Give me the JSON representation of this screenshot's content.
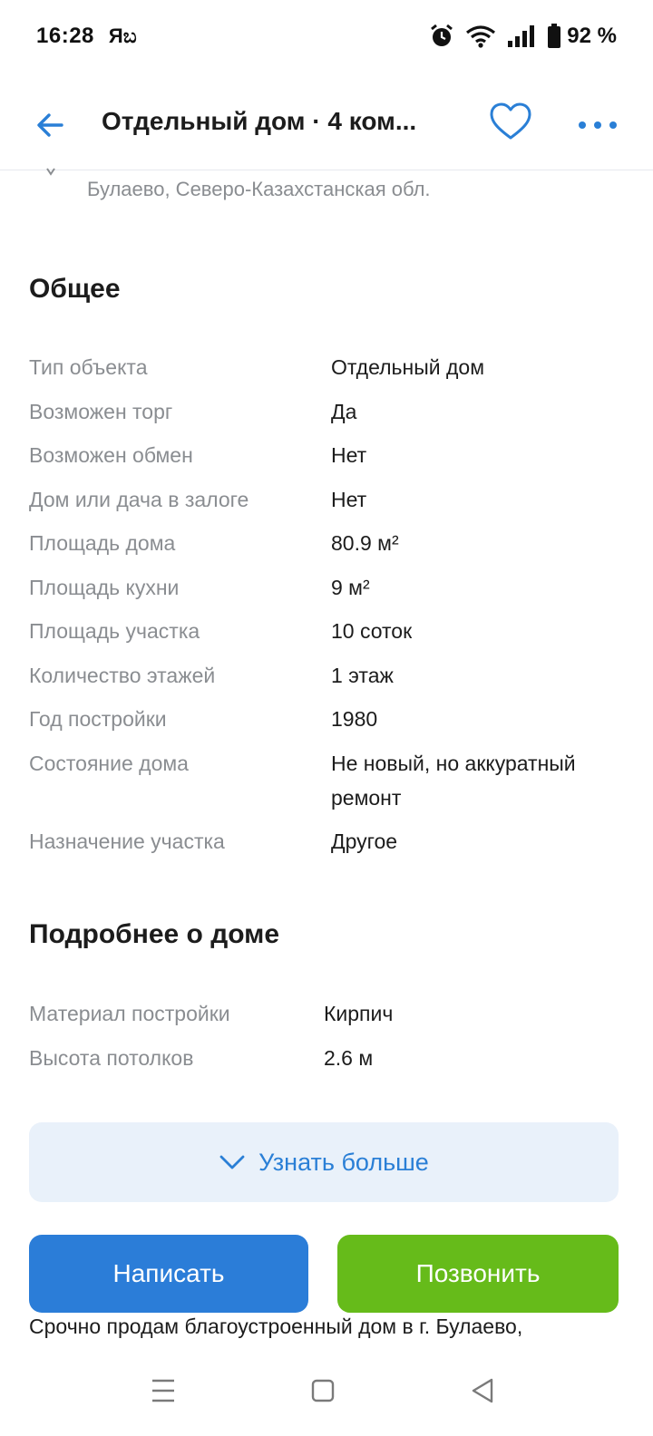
{
  "status_bar": {
    "time": "16:28",
    "notification": "Яಬ",
    "battery": "92 %"
  },
  "header": {
    "title": "Отдельный дом · 4 ком..."
  },
  "listing": {
    "address": "Булаево, Северо-Казахстанская обл."
  },
  "general": {
    "title": "Общее",
    "rows": [
      {
        "label": "Тип объекта",
        "value": "Отдельный дом"
      },
      {
        "label": "Возможен торг",
        "value": "Да"
      },
      {
        "label": "Возможен обмен",
        "value": "Нет"
      },
      {
        "label": "Дом или дача в залоге",
        "value": "Нет"
      },
      {
        "label": "Площадь дома",
        "value": "80.9 м²"
      },
      {
        "label": "Площадь кухни",
        "value": "9 м²"
      },
      {
        "label": "Площадь участка",
        "value": "10 соток"
      },
      {
        "label": "Количество этажей",
        "value": "1 этаж"
      },
      {
        "label": "Год постройки",
        "value": "1980"
      },
      {
        "label": "Состояние дома",
        "value": "Не новый, но аккуратный ремонт"
      },
      {
        "label": "Назначение участка",
        "value": "Другое"
      }
    ]
  },
  "house_details": {
    "title": "Подробнее о доме",
    "rows": [
      {
        "label": "Материал постройки",
        "value": "Кирпич"
      },
      {
        "label": "Высота потолков",
        "value": "2.6 м"
      }
    ]
  },
  "actions": {
    "more_label": "Узнать больше",
    "write_label": "Написать",
    "call_label": "Позвонить"
  },
  "description": {
    "text": "Срочно продам благоустроенный дом в г. Булаево,"
  },
  "colors": {
    "accent": "#2a7fd6",
    "write_button": "#2b7dd8",
    "call_button": "#66bb1a",
    "more_bg": "#e9f1fa"
  }
}
